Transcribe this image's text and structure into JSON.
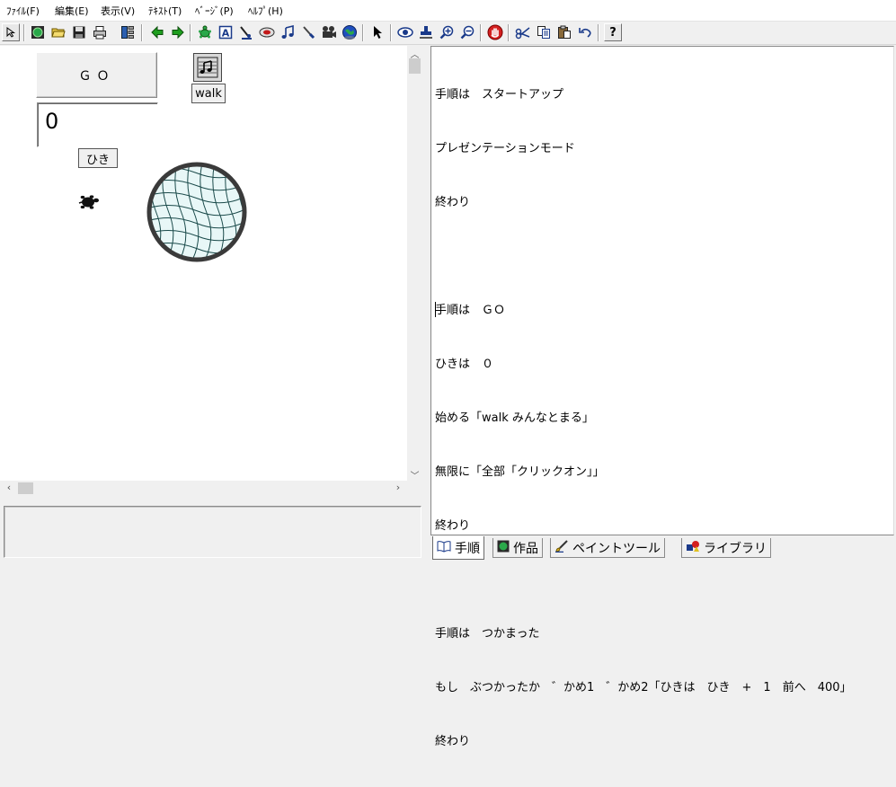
{
  "menu": [
    {
      "label": "ﾌｧｲﾙ(F)"
    },
    {
      "label": "編集(E)"
    },
    {
      "label": "表示(V)"
    },
    {
      "label": "ﾃｷｽﾄ(T)"
    },
    {
      "label": "ﾍﾞｰｼﾞ(P)"
    },
    {
      "label": "ﾍﾙﾌﾟ(H)"
    }
  ],
  "toolbar": {
    "icons": [
      "select-arrow-icon",
      "globe-icon",
      "open-folder-icon",
      "save-icon",
      "print-icon",
      "panels-icon",
      "back-arrow-icon",
      "forward-arrow-icon",
      "turtle-icon",
      "text-box-icon",
      "pen-icon",
      "button-icon",
      "music-note-icon",
      "paint-brush-icon",
      "movie-camera-icon",
      "earth-icon",
      "pointer-icon",
      "eye-icon",
      "stamp-icon",
      "zoom-in-icon",
      "zoom-out-icon",
      "stop-hand-icon",
      "scissors-icon",
      "copy-icon",
      "paste-icon",
      "undo-icon",
      "help-icon"
    ],
    "help_label": "?"
  },
  "stage": {
    "go_button_label": "ＧＯ",
    "count_value": "0",
    "count_label": "ひき",
    "walk_label": "walk"
  },
  "editor": {
    "lines": [
      "手順は　スタートアップ",
      "プレゼンテーションモード",
      "終わり",
      "",
      "手順は　ＧＯ",
      "ひきは　０",
      "始める「walk みんなとまる」",
      "無限に「全部「クリックオン」」",
      "終わり",
      "",
      "手順は　つかまった",
      "もし　ぶつかったか　゛かめ1　゛かめ2「ひきは　ひき　+　1　前へ　400」",
      "終わり"
    ]
  },
  "tabs": [
    {
      "label": "手順",
      "icon": "book-icon",
      "active": true
    },
    {
      "label": "作品",
      "icon": "globe-icon",
      "active": false
    },
    {
      "label": "ペイントツール",
      "icon": "brush-icon",
      "active": false
    },
    {
      "label": "ライブラリ",
      "icon": "shapes-icon",
      "active": false
    }
  ],
  "colors": {
    "net_fill": "#e8f7f7",
    "net_border": "#3a3a3a",
    "toolbar_green": "#1e9e1e"
  }
}
